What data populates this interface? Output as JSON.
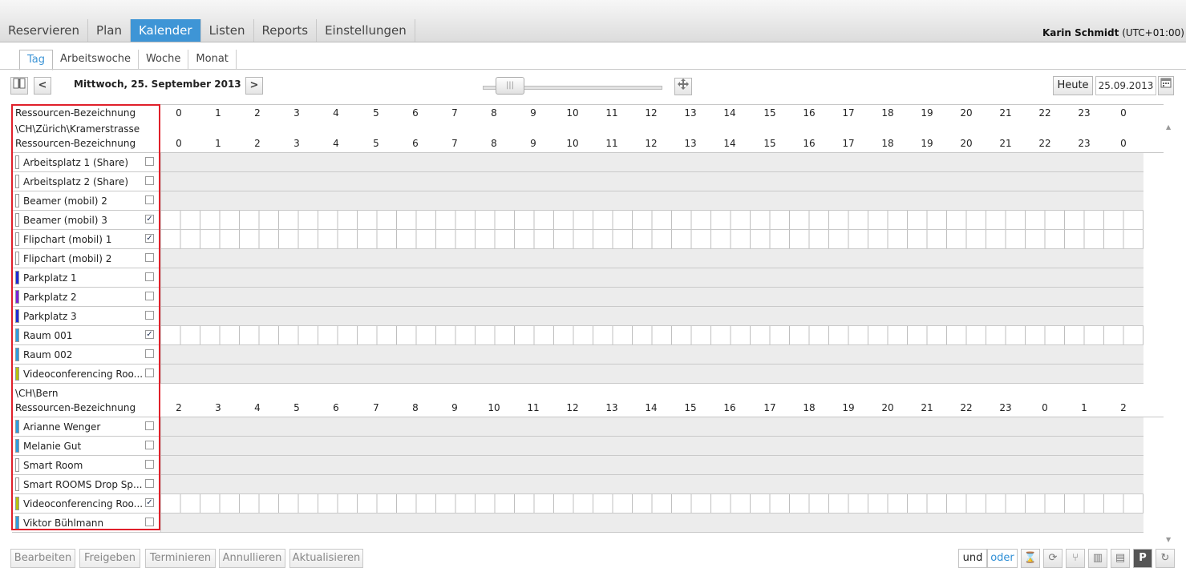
{
  "nav": {
    "tabs": [
      "Reservieren",
      "Plan",
      "Kalender",
      "Listen",
      "Reports",
      "Einstellungen"
    ],
    "active_tab": "Kalender",
    "user_name": "Karin Schmidt",
    "user_tz": "(UTC+01:00)"
  },
  "subtabs": {
    "items": [
      "Tag",
      "Arbeitswoche",
      "Woche",
      "Monat"
    ],
    "active": "Tag"
  },
  "toolbar": {
    "date_title": "Mittwoch, 25. September 2013",
    "today_label": "Heute",
    "date_value": "25.09.2013",
    "prev_label": "<",
    "next_label": ">",
    "book_icon": "book-icon",
    "move_icon": "move-icon",
    "calendar_icon": "calendar-icon",
    "zoom_level": 0.12
  },
  "grid": {
    "header_label": "Ressourcen-Bezeichnung",
    "hours_main": [
      "0",
      "1",
      "2",
      "3",
      "4",
      "5",
      "6",
      "7",
      "8",
      "9",
      "10",
      "11",
      "12",
      "13",
      "14",
      "15",
      "16",
      "17",
      "18",
      "19",
      "20",
      "21",
      "22",
      "23",
      "0"
    ],
    "hours_bern": [
      "2",
      "3",
      "4",
      "5",
      "6",
      "7",
      "8",
      "9",
      "10",
      "11",
      "12",
      "13",
      "14",
      "15",
      "16",
      "17",
      "18",
      "19",
      "20",
      "21",
      "22",
      "23",
      "0",
      "1",
      "2"
    ],
    "groups": [
      {
        "path": "\\CH\\Zürich\\Kramerstrasse",
        "header_label": "Ressourcen-Bezeichnung",
        "resources": [
          {
            "name": "Arbeitsplatz 1 (Share)",
            "color": "#ffffff",
            "checked": false
          },
          {
            "name": "Arbeitsplatz 2 (Share)",
            "color": "#ffffff",
            "checked": false
          },
          {
            "name": "Beamer (mobil) 2",
            "color": "#ffffff",
            "checked": false
          },
          {
            "name": "Beamer (mobil) 3",
            "color": "#ffffff",
            "checked": true
          },
          {
            "name": "Flipchart (mobil) 1",
            "color": "#ffffff",
            "checked": true
          },
          {
            "name": "Flipchart (mobil) 2",
            "color": "#ffffff",
            "checked": false
          },
          {
            "name": "Parkplatz 1",
            "color": "#1f2bd6",
            "checked": false
          },
          {
            "name": "Parkplatz 2",
            "color": "#7a22d8",
            "checked": false
          },
          {
            "name": "Parkplatz 3",
            "color": "#1f2bd6",
            "checked": false
          },
          {
            "name": "Raum 001",
            "color": "#2f9be0",
            "checked": true
          },
          {
            "name": "Raum 002",
            "color": "#2f9be0",
            "checked": false
          },
          {
            "name": "Videoconferencing Roo...",
            "color": "#b8c20d",
            "checked": false
          }
        ]
      },
      {
        "path": "\\CH\\Bern",
        "header_label": "Ressourcen-Bezeichnung",
        "resources": [
          {
            "name": "Arianne Wenger",
            "color": "#2f9be0",
            "checked": false
          },
          {
            "name": "Melanie Gut",
            "color": "#2f9be0",
            "checked": false
          },
          {
            "name": "Smart Room",
            "color": "#ffffff",
            "checked": false
          },
          {
            "name": "Smart ROOMS Drop Sp...",
            "color": "#ffffff",
            "checked": false
          },
          {
            "name": "Videoconferencing Roo...",
            "color": "#b8c20d",
            "checked": true
          },
          {
            "name": "Viktor Bühlmann",
            "color": "#2f9be0",
            "checked": false
          }
        ]
      }
    ]
  },
  "bottom": {
    "buttons": [
      "Bearbeiten",
      "Freigeben",
      "Terminieren",
      "Annullieren",
      "Aktualisieren"
    ],
    "und": "und",
    "oder": "oder",
    "icons": [
      "hourglass-icon",
      "sync-icon",
      "restaurant-icon",
      "columns-icon",
      "printer-icon",
      "parking-icon",
      "refresh-icon"
    ],
    "icon_glyphs": [
      "⌛",
      "⟳",
      "⑂",
      "▥",
      "▤",
      "P",
      "↻"
    ]
  }
}
